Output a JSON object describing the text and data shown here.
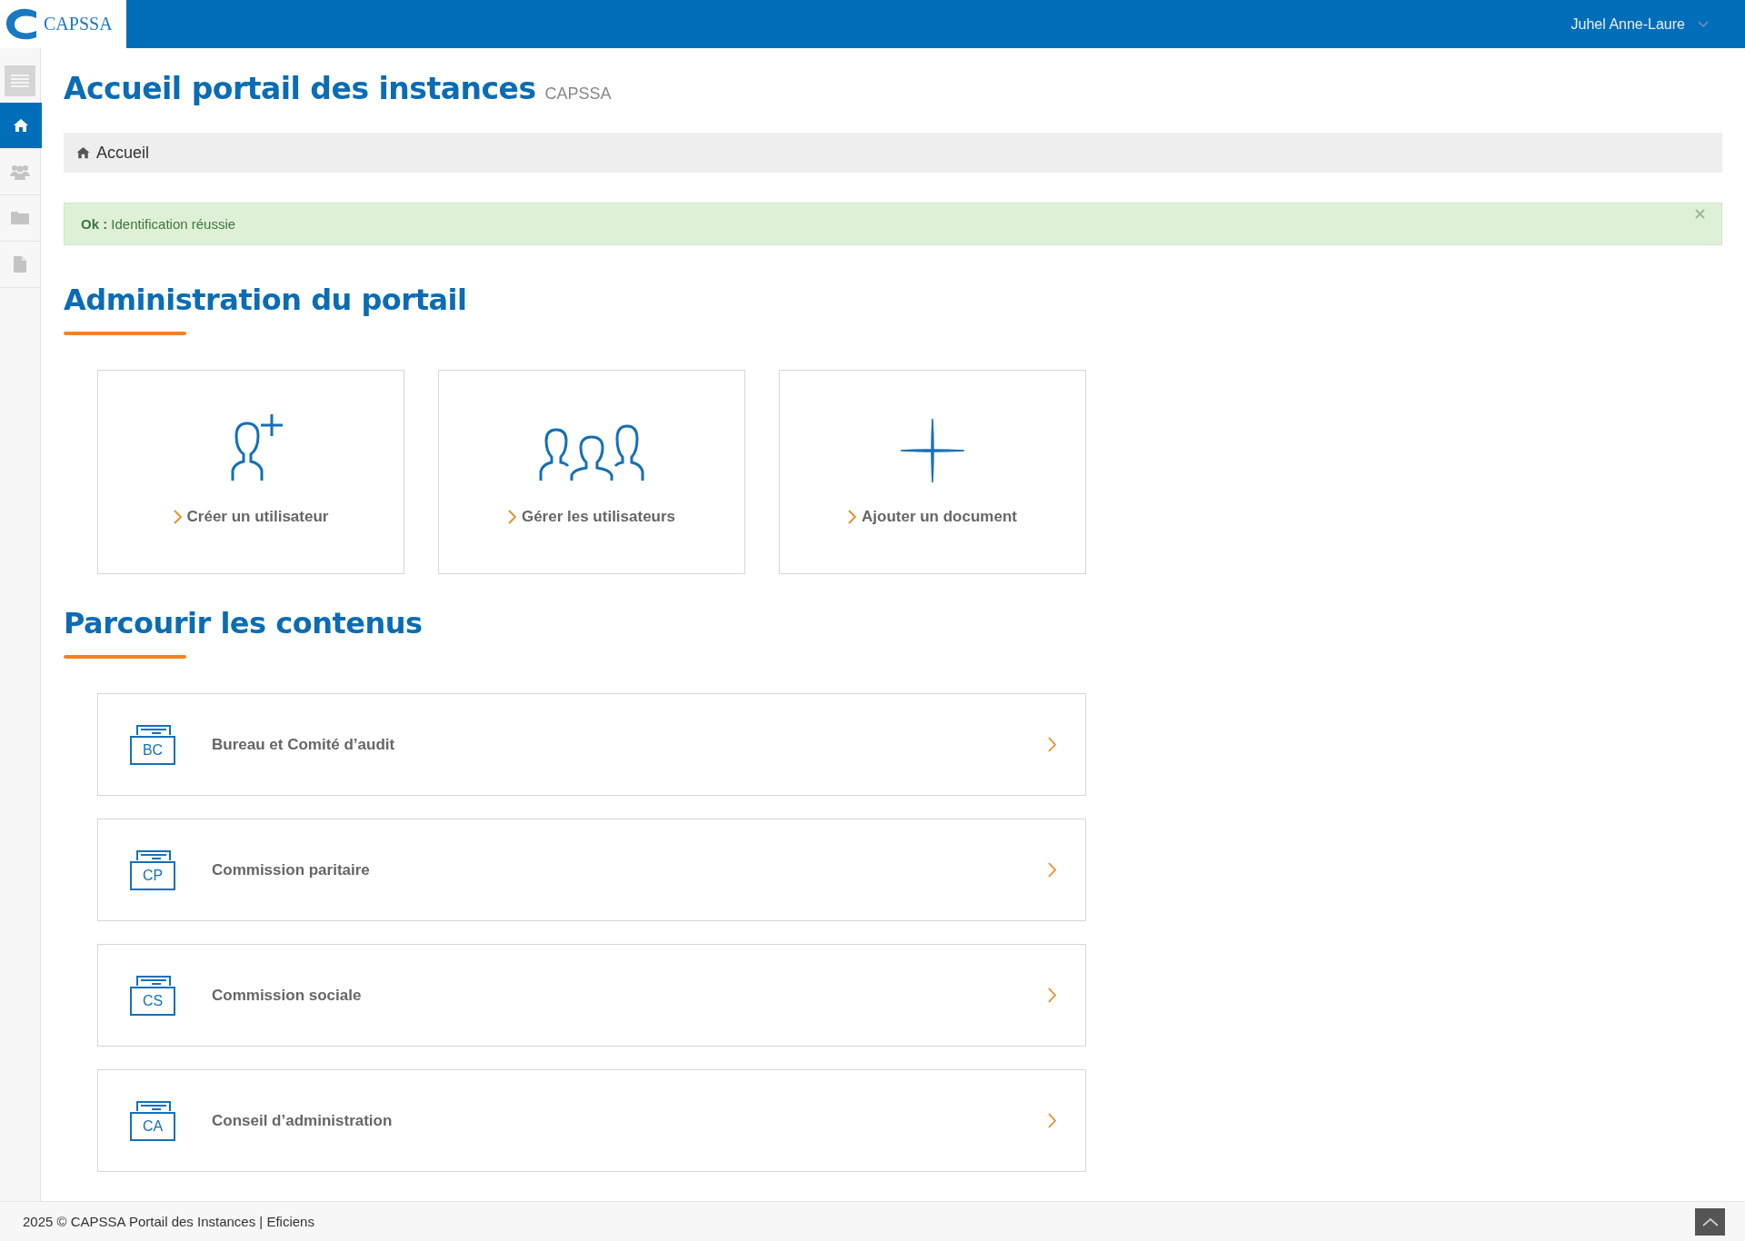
{
  "header": {
    "logo_text": "CAPSSA",
    "user": "Juhel Anne-Laure"
  },
  "sidebar": {
    "items": [
      {
        "kind": "menu",
        "selected": false
      },
      {
        "kind": "home",
        "selected": true
      },
      {
        "kind": "users",
        "selected": false
      },
      {
        "kind": "folder",
        "selected": false
      },
      {
        "kind": "document",
        "selected": false
      }
    ]
  },
  "page": {
    "title": "Accueil portail des instances",
    "subtitle": "CAPSSA"
  },
  "breadcrumb": [
    "Accueil"
  ],
  "alert": {
    "label": "Ok :",
    "message": "Identification réussie"
  },
  "sections": [
    {
      "title": "Administration du portail",
      "kind": "tiles",
      "items": [
        {
          "kind": "user-add",
          "label": "Créer un utilisateur"
        },
        {
          "kind": "users",
          "label": "Gérer les utilisateurs"
        },
        {
          "kind": "plus",
          "label": "Ajouter un document"
        }
      ]
    },
    {
      "title": "Parcourir les contenus",
      "kind": "list",
      "items": [
        {
          "code": "BC",
          "label": "Bureau et Comité d’audit"
        },
        {
          "code": "CP",
          "label": "Commission paritaire"
        },
        {
          "code": "CS",
          "label": "Commission sociale"
        },
        {
          "code": "CA",
          "label": "Conseil d’administration"
        }
      ]
    }
  ],
  "footer": "2025 © CAPSSA Portail des Instances | Eficiens"
}
